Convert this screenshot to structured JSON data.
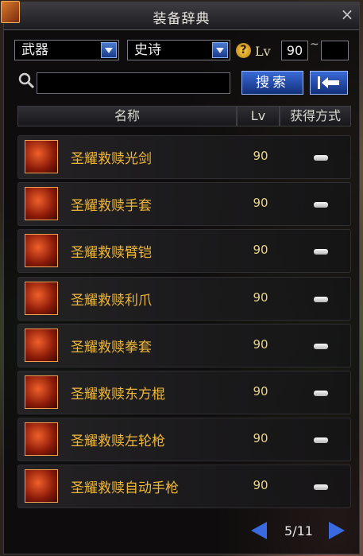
{
  "window": {
    "title": "装备辞典",
    "close_label": "×"
  },
  "filters": {
    "category": "武器",
    "rarity": "史诗",
    "lv_label": "Lv",
    "lv_min": "90",
    "lv_max": "",
    "range_separator": "~"
  },
  "search": {
    "value": "",
    "button_label": "搜索"
  },
  "columns": {
    "name": "名称",
    "lv": "Lv",
    "acquire": "获得方式"
  },
  "items": [
    {
      "name": "圣耀救赎光剑",
      "lv": "90"
    },
    {
      "name": "圣耀救赎手套",
      "lv": "90"
    },
    {
      "name": "圣耀救赎臂铠",
      "lv": "90"
    },
    {
      "name": "圣耀救赎利爪",
      "lv": "90"
    },
    {
      "name": "圣耀救赎拳套",
      "lv": "90"
    },
    {
      "name": "圣耀救赎东方棍",
      "lv": "90"
    },
    {
      "name": "圣耀救赎左轮枪",
      "lv": "90"
    },
    {
      "name": "圣耀救赎自动手枪",
      "lv": "90"
    }
  ],
  "pager": {
    "text": "5/11"
  },
  "icons": {
    "close": "close-icon",
    "help": "question-icon",
    "search": "magnifier-icon",
    "back": "back-arrow-icon",
    "prev": "prev-arrow-icon",
    "next": "next-arrow-icon"
  },
  "colors": {
    "item_name": "#f0b838",
    "button": "#2a56c0",
    "accent": "#3a6ae0"
  }
}
